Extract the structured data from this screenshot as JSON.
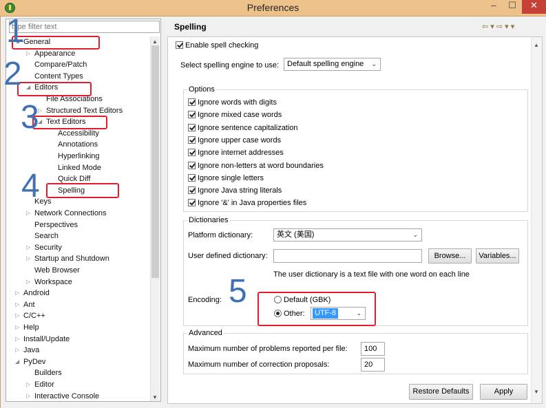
{
  "window": {
    "title": "Preferences"
  },
  "filter": {
    "placeholder": "type filter text"
  },
  "tree": [
    {
      "label": "General",
      "twisty": "▲",
      "indent": 1
    },
    {
      "label": "Appearance",
      "twisty": "▷",
      "indent": 2
    },
    {
      "label": "Compare/Patch",
      "twisty": "",
      "indent": 2
    },
    {
      "label": "Content Types",
      "twisty": "",
      "indent": 2
    },
    {
      "label": "Editors",
      "twisty": "◢",
      "indent": 2
    },
    {
      "label": "File Associations",
      "twisty": "",
      "indent": 3
    },
    {
      "label": "Structured Text Editors",
      "twisty": "▷",
      "indent": 3
    },
    {
      "label": "Text Editors",
      "twisty": "◢",
      "indent": 3
    },
    {
      "label": "Accessibility",
      "twisty": "",
      "indent": 4
    },
    {
      "label": "Annotations",
      "twisty": "",
      "indent": 4
    },
    {
      "label": "Hyperlinking",
      "twisty": "",
      "indent": 4
    },
    {
      "label": "Linked Mode",
      "twisty": "",
      "indent": 4
    },
    {
      "label": "Quick Diff",
      "twisty": "",
      "indent": 4
    },
    {
      "label": "Spelling",
      "twisty": "",
      "indent": 4
    },
    {
      "label": "Keys",
      "twisty": "",
      "indent": 2
    },
    {
      "label": "Network Connections",
      "twisty": "▷",
      "indent": 2
    },
    {
      "label": "Perspectives",
      "twisty": "",
      "indent": 2
    },
    {
      "label": "Search",
      "twisty": "",
      "indent": 2
    },
    {
      "label": "Security",
      "twisty": "▷",
      "indent": 2
    },
    {
      "label": "Startup and Shutdown",
      "twisty": "▷",
      "indent": 2
    },
    {
      "label": "Web Browser",
      "twisty": "",
      "indent": 2
    },
    {
      "label": "Workspace",
      "twisty": "▷",
      "indent": 2
    },
    {
      "label": "Android",
      "twisty": "▷",
      "indent": 1
    },
    {
      "label": "Ant",
      "twisty": "▷",
      "indent": 1
    },
    {
      "label": "C/C++",
      "twisty": "▷",
      "indent": 1
    },
    {
      "label": "Help",
      "twisty": "▷",
      "indent": 1
    },
    {
      "label": "Install/Update",
      "twisty": "▷",
      "indent": 1
    },
    {
      "label": "Java",
      "twisty": "▷",
      "indent": 1
    },
    {
      "label": "PyDev",
      "twisty": "◢",
      "indent": 1
    },
    {
      "label": "Builders",
      "twisty": "",
      "indent": 2
    },
    {
      "label": "Editor",
      "twisty": "▷",
      "indent": 2
    },
    {
      "label": "Interactive Console",
      "twisty": "▷",
      "indent": 2
    }
  ],
  "page": {
    "title": "Spelling",
    "nav_arrows": "⇦ ▾ ⇨ ▾ ▾",
    "enable_label": "Enable spell checking",
    "engine_label": "Select spelling engine to use:",
    "engine_value": "Default spelling engine",
    "options_title": "Options",
    "options": [
      {
        "label": "Ignore words with digits",
        "checked": true
      },
      {
        "label": "Ignore mixed case words",
        "checked": true
      },
      {
        "label": "Ignore sentence capitalization",
        "checked": true
      },
      {
        "label": "Ignore upper case words",
        "checked": true
      },
      {
        "label": "Ignore internet addresses",
        "checked": true
      },
      {
        "label": "Ignore non-letters at word boundaries",
        "checked": true
      },
      {
        "label": "Ignore single letters",
        "checked": true
      },
      {
        "label": "Ignore Java string literals",
        "checked": true
      },
      {
        "label": "Ignore '&' in Java properties files",
        "checked": true
      }
    ],
    "dictionaries_title": "Dictionaries",
    "platform_dict_label": "Platform dictionary:",
    "platform_dict_value": "英文 (美国)",
    "user_dict_label": "User defined dictionary:",
    "user_dict_value": "",
    "browse_label": "Browse...",
    "variables_label": "Variables...",
    "user_dict_hint": "The user dictionary is a text file with one word on each line",
    "encoding_label": "Encoding:",
    "encoding_default": "Default (GBK)",
    "encoding_other": "Other:",
    "encoding_other_value": "UTF-8",
    "advanced_title": "Advanced",
    "max_problems_label": "Maximum number of problems reported per file:",
    "max_problems_value": "100",
    "max_proposals_label": "Maximum number of correction proposals:",
    "max_proposals_value": "20",
    "restore_label": "Restore Defaults",
    "apply_label": "Apply"
  },
  "annotations": [
    "1",
    "2",
    "3",
    "4",
    "5"
  ]
}
